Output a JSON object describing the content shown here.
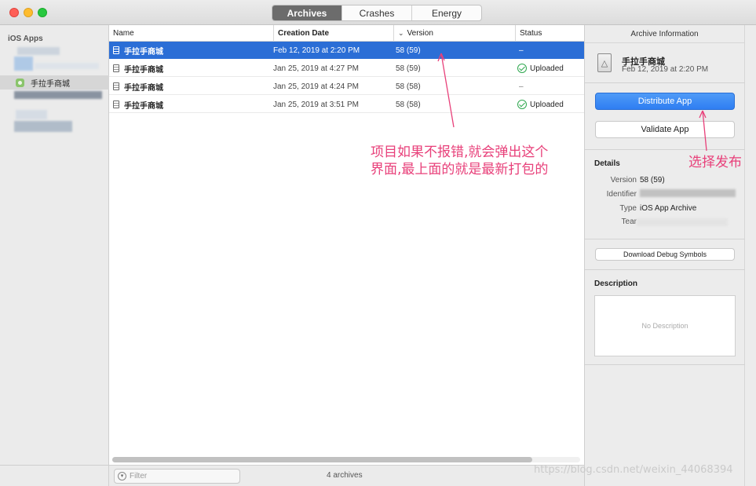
{
  "window": {
    "tabs": [
      {
        "label": "Archives",
        "active": true
      },
      {
        "label": "Crashes",
        "active": false
      },
      {
        "label": "Energy",
        "active": false
      }
    ]
  },
  "sidebar": {
    "header": "iOS Apps",
    "selected_app": "手拉手商城"
  },
  "table": {
    "columns": [
      "Name",
      "Creation Date",
      "Version",
      "Status"
    ],
    "sort_indicator_column": "Version",
    "rows": [
      {
        "name": "手拉手商城",
        "date": "Feb 12, 2019 at 2:20 PM",
        "version": "58 (59)",
        "status": "–",
        "uploaded": false,
        "selected": true
      },
      {
        "name": "手拉手商城",
        "date": "Jan 25, 2019 at 4:27 PM",
        "version": "58 (59)",
        "status": "Uploaded",
        "uploaded": true,
        "selected": false
      },
      {
        "name": "手拉手商城",
        "date": "Jan 25, 2019 at 4:24 PM",
        "version": "58 (58)",
        "status": "–",
        "uploaded": false,
        "selected": false
      },
      {
        "name": "手拉手商城",
        "date": "Jan 25, 2019 at 3:51 PM",
        "version": "58 (58)",
        "status": "Uploaded",
        "uploaded": true,
        "selected": false
      }
    ]
  },
  "bottombar": {
    "filter_placeholder": "Filter",
    "count": "4 archives"
  },
  "inspector": {
    "header": "Archive Information",
    "archive_name": "手拉手商城",
    "archive_date": "Feb 12, 2019 at 2:20 PM",
    "distribute_label": "Distribute App",
    "validate_label": "Validate App",
    "details_title": "Details",
    "details": {
      "version_key": "Version",
      "version_val": "58 (59)",
      "identifier_key": "Identifier",
      "type_key": "Type",
      "type_val": "iOS App Archive",
      "team_key": "Tear"
    },
    "download_symbols_label": "Download Debug Symbols",
    "description_title": "Description",
    "no_description": "No Description"
  },
  "annotations": {
    "note_line1": "项目如果不报错,就会弹出这个",
    "note_line2": "界面,最上面的就是最新打包的",
    "choose_publish": "选择发布"
  },
  "watermark": "https://blog.csdn.net/weixin_44068394",
  "colors": {
    "selection": "#2b6ed6",
    "primary_button": "#3a88f4",
    "annotation": "#e8407a",
    "uploaded_check": "#2fa84f"
  }
}
